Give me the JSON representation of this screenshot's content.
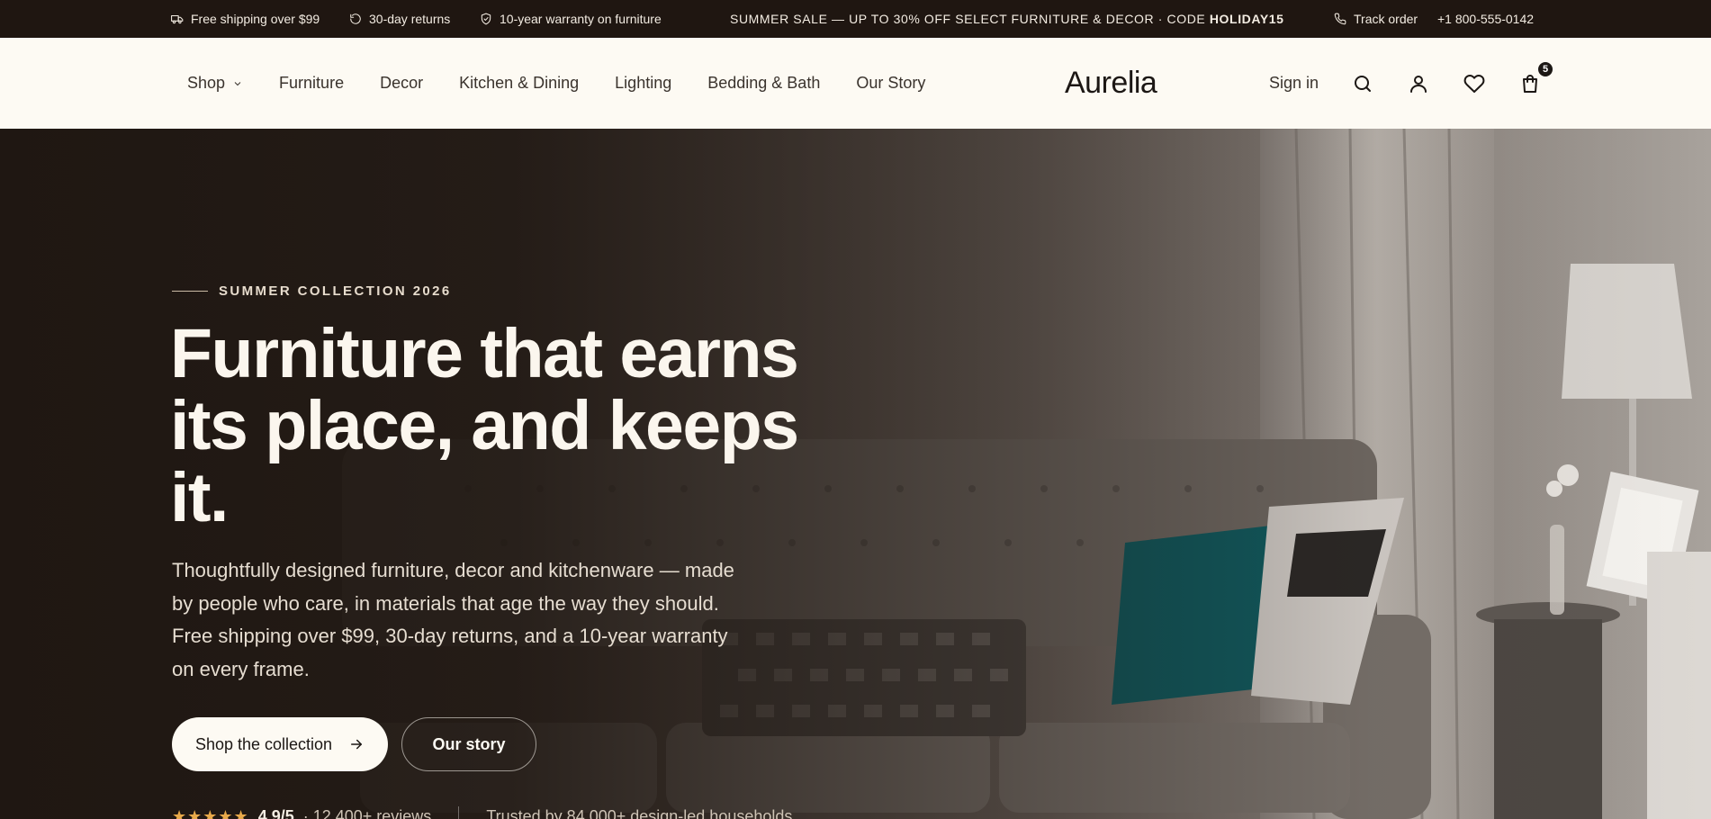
{
  "announcement": {
    "items": [
      {
        "icon": "truck-icon",
        "label": "Free shipping over $99"
      },
      {
        "icon": "returns-icon",
        "label": "30-day returns"
      },
      {
        "icon": "shield-icon",
        "label": "10-year warranty on furniture"
      }
    ],
    "sale_text": "SUMMER SALE — UP TO 30% OFF SELECT FURNITURE & DECOR · CODE ",
    "sale_code": "HOLIDAY15",
    "track_order": "Track order",
    "phone": "+1 800-555-0142"
  },
  "header": {
    "nav": [
      "Shop",
      "Furniture",
      "Decor",
      "Kitchen & Dining",
      "Lighting",
      "Bedding & Bath",
      "Our Story"
    ],
    "logo": "Aurelia",
    "sign_in": "Sign in",
    "cart_count": "5"
  },
  "hero": {
    "eyebrow": "SUMMER COLLECTION 2026",
    "headline": "Furniture that earns its place, and keeps it.",
    "subtext": "Thoughtfully designed furniture, decor and kitchenware — made by people who care, in materials that age the way they should. Free shipping over $99, 30-day returns, and a 10-year warranty on every frame.",
    "primary_cta": "Shop the collection",
    "secondary_cta": "Our story",
    "stars": "★★★★★",
    "rating": "4.9/5",
    "reviews": "· 12,400+ reviews",
    "trusted": "Trusted by 84,000+ design-led households"
  },
  "colors": {
    "announcement_bg": "#1f1611",
    "header_bg": "#fdfaf3",
    "hero_text": "#fbf6ee",
    "star": "#e8a94a",
    "accent_teal": "#0f5a5f"
  }
}
